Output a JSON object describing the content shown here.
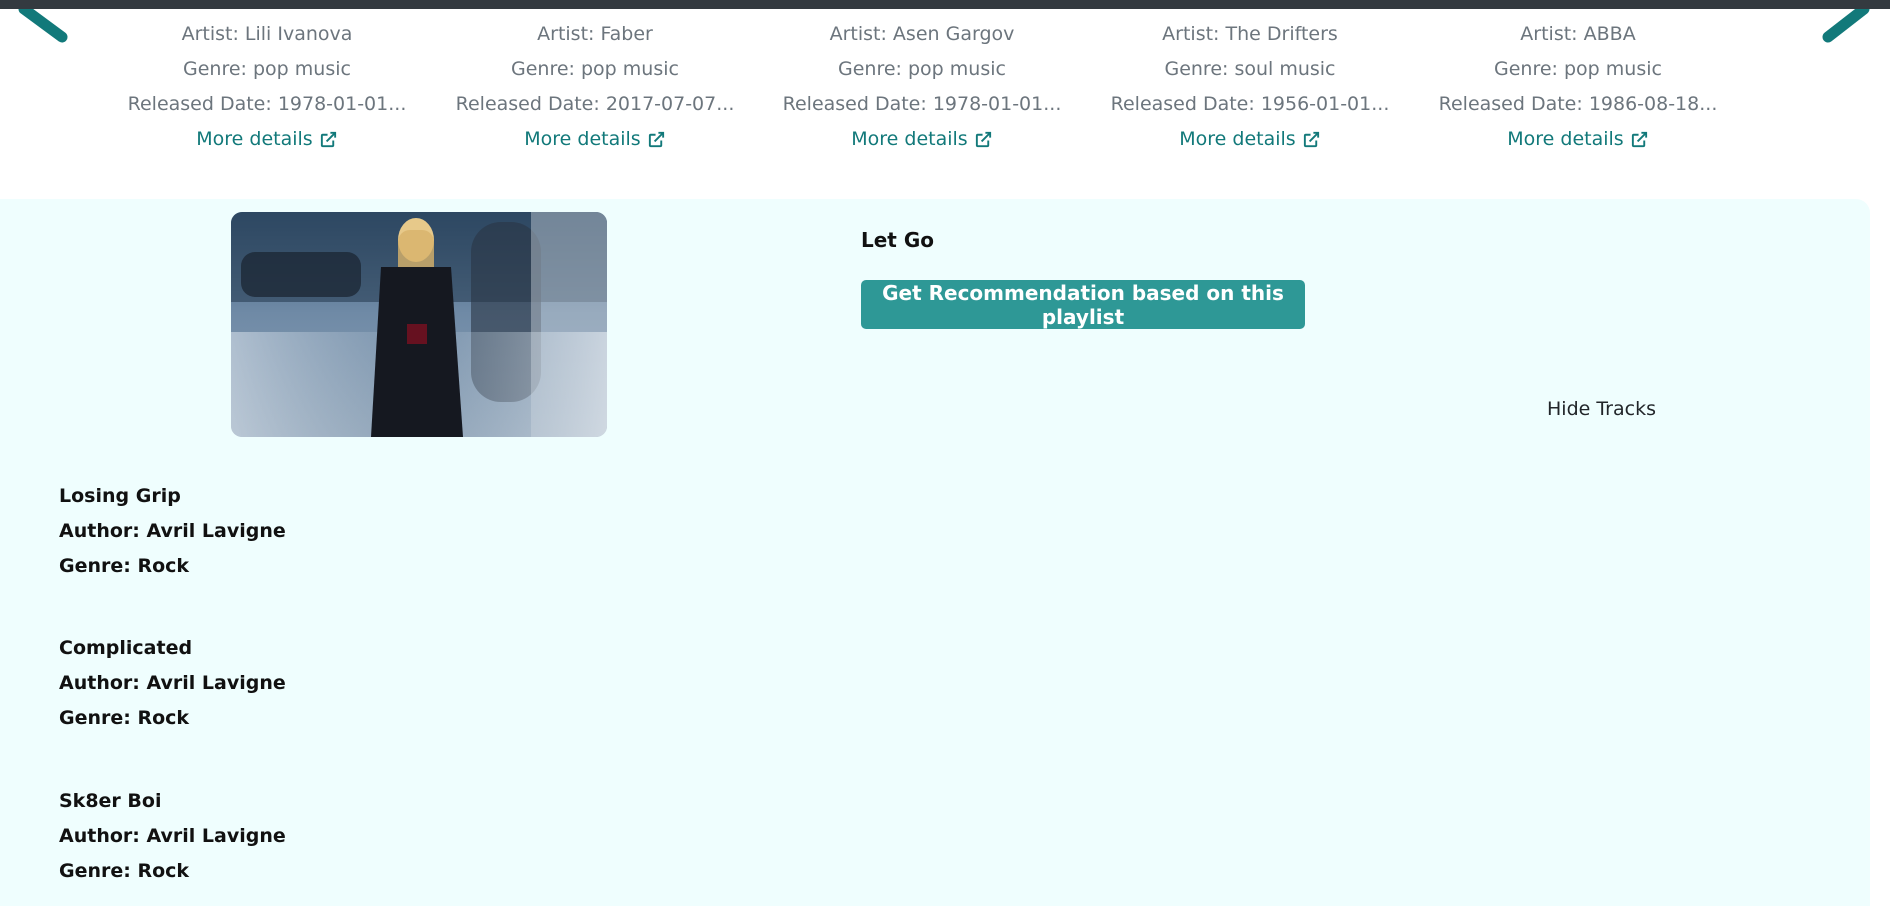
{
  "colors": {
    "accent": "#2e9896",
    "link": "#12797a",
    "panel_bg": "#effefe",
    "topbar": "#343a40",
    "muted_text": "#6c757d"
  },
  "carousel": {
    "prev_icon": "chevron-left-icon",
    "next_icon": "chevron-right-icon",
    "cards": [
      {
        "artist": "Artist: Lili Ivanova",
        "genre": "Genre: pop music",
        "released": "Released Date: 1978-01-01...",
        "more": "More details"
      },
      {
        "artist": "Artist: Faber",
        "genre": "Genre: pop music",
        "released": "Released Date: 2017-07-07...",
        "more": "More details"
      },
      {
        "artist": "Artist: Asen Gargov",
        "genre": "Genre: pop music",
        "released": "Released Date: 1978-01-01...",
        "more": "More details"
      },
      {
        "artist": "Artist: The Drifters",
        "genre": "Genre: soul music",
        "released": "Released Date: 1956-01-01...",
        "more": "More details"
      },
      {
        "artist": "Artist: ABBA",
        "genre": "Genre: pop music",
        "released": "Released Date: 1986-08-18...",
        "more": "More details"
      }
    ]
  },
  "playlist": {
    "title": "Let Go",
    "recommend_label": "Get Recommendation based on this playlist",
    "hide_tracks_label": "Hide Tracks",
    "tracks": [
      {
        "title": "Losing Grip",
        "author": "Author: Avril Lavigne",
        "genre": "Genre: Rock"
      },
      {
        "title": "Complicated",
        "author": "Author: Avril Lavigne",
        "genre": "Genre: Rock"
      },
      {
        "title": "Sk8er Boi",
        "author": "Author: Avril Lavigne",
        "genre": "Genre: Rock"
      }
    ]
  }
}
